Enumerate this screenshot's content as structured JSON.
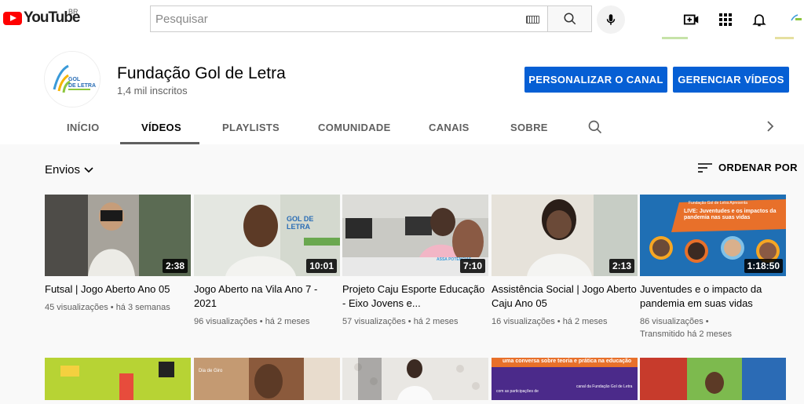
{
  "header": {
    "logo_text": "YouTube",
    "region": "BR",
    "search_placeholder": "Pesquisar"
  },
  "channel": {
    "name": "Fundação Gol de Letra",
    "subscribers": "1,4 mil inscritos",
    "customize_button": "PERSONALIZAR O CANAL",
    "manage_button": "GERENCIAR VÍDEOS",
    "avatar_logo_text": "GOL DE LETRA"
  },
  "tabs": [
    {
      "label": "INÍCIO"
    },
    {
      "label": "VÍDEOS"
    },
    {
      "label": "PLAYLISTS"
    },
    {
      "label": "COMUNIDADE"
    },
    {
      "label": "CANAIS"
    },
    {
      "label": "SOBRE"
    }
  ],
  "sort": {
    "filter_label": "Envios",
    "order_label": "ORDENAR POR"
  },
  "videos": [
    {
      "title": "Futsal | Jogo Aberto Ano 05",
      "duration": "2:38",
      "views": "45 visualizações",
      "age": "há 3 semanas"
    },
    {
      "title": "Jogo Aberto na Vila Ano 7 - 2021",
      "duration": "10:01",
      "views": "96 visualizações",
      "age": "há 2 meses"
    },
    {
      "title": "Projeto Caju Esporte Educação - Eixo Jovens e...",
      "duration": "7:10",
      "views": "57 visualizações",
      "age": "há 2 meses"
    },
    {
      "title": "Assistência Social | Jogo Aberto Caju Ano 05",
      "duration": "2:13",
      "views": "16 visualizações",
      "age": "há 2 meses"
    },
    {
      "title": "Juventudes e o impacto da pandemia em suas vidas",
      "duration": "1:18:50",
      "views": "86 visualizações",
      "age": "Transmitido há 2 meses"
    }
  ],
  "thumb_texts": {
    "v2_logo": "GOL DE LETRA",
    "v3_shirt": "ASSA POTENCIAS",
    "v5_header": "Fundação Gol de Letra Apresenta",
    "v5_title": "LIVE: Juventudes e os impactos da pandemia nas suas vidas",
    "r2_v2_label": "Dia de Giro",
    "r2_v4_header": "uma conversa sobre teoria e prática na educação",
    "r2_v4_sub": "com as participações de",
    "r2_v4_right": "canal da Fundação Gol de Letra"
  }
}
